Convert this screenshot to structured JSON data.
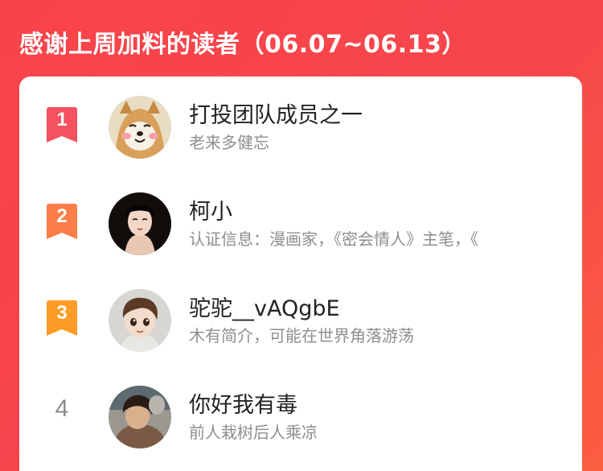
{
  "header": {
    "title": "感谢上周加料的读者（06.07~06.13）"
  },
  "readers": [
    {
      "rank": "1",
      "name": "打投团队成员之一",
      "description": "老来多健忘",
      "badge_color": "#f5515f"
    },
    {
      "rank": "2",
      "name": "柯小",
      "description": "认证信息：漫画家，《密会情人》主笔，《",
      "badge_color": "#fb7e48"
    },
    {
      "rank": "3",
      "name": "驼驼__vAQgbE",
      "description": "木有简介，可能在世界角落游荡",
      "badge_color": "#fb9c27"
    },
    {
      "rank": "4",
      "name": "你好我有毒",
      "description": "前人栽树后人乘凉"
    }
  ],
  "colors": {
    "background": "#f6464c",
    "card": "#ffffff",
    "name_text": "#222222",
    "desc_text": "#8e8e8e"
  }
}
